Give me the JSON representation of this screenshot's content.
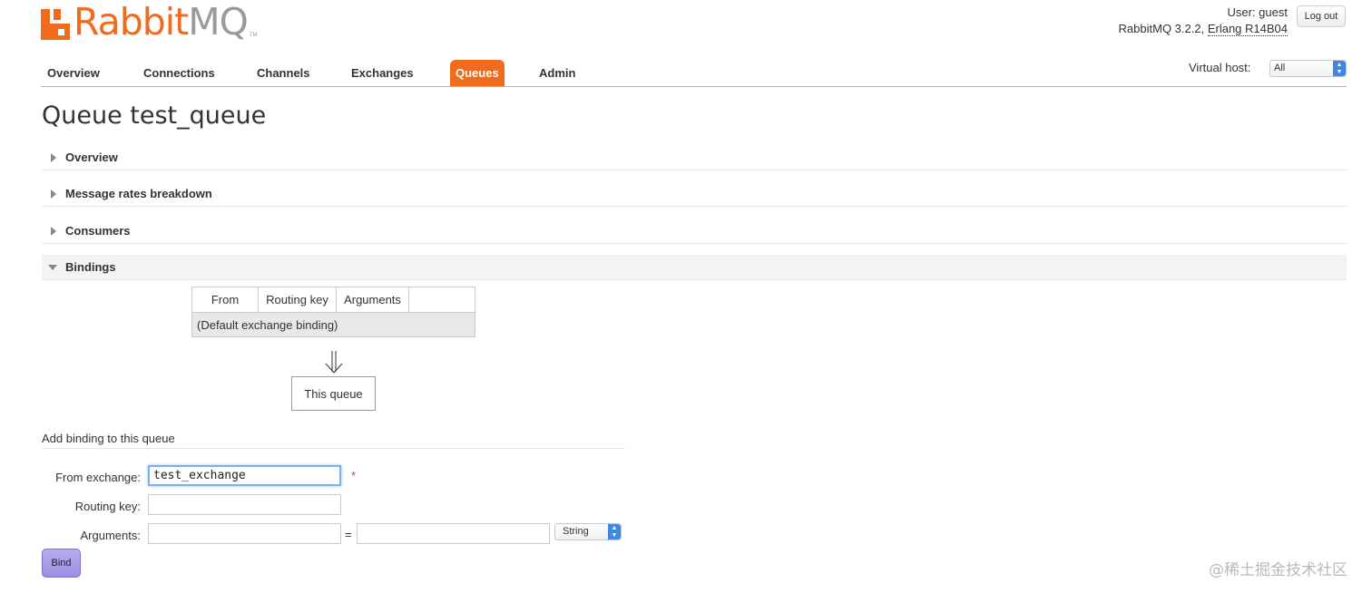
{
  "logo": {
    "name_orange": "Rabbit",
    "name_grey": "MQ",
    "tm": "TM"
  },
  "header": {
    "user": "User: guest",
    "version": "RabbitMQ 3.2.2, ",
    "erlang": "Erlang R14B04",
    "logout_label": "Log out"
  },
  "nav": {
    "items": [
      {
        "label": "Overview"
      },
      {
        "label": "Connections"
      },
      {
        "label": "Channels"
      },
      {
        "label": "Exchanges"
      },
      {
        "label": "Queues",
        "active": true
      },
      {
        "label": "Admin"
      }
    ],
    "vhost_label": "Virtual host:",
    "vhost_value": "All"
  },
  "page": {
    "title": "Queue test_queue"
  },
  "sections": [
    {
      "title": "Overview",
      "expanded": false
    },
    {
      "title": "Message rates breakdown",
      "expanded": false
    },
    {
      "title": "Consumers",
      "expanded": false
    },
    {
      "title": "Bindings",
      "expanded": true
    }
  ],
  "bindings": {
    "columns": [
      "From",
      "Routing key",
      "Arguments",
      ""
    ],
    "rows": [
      "(Default exchange binding)"
    ],
    "this_queue_label": "This queue"
  },
  "add_binding": {
    "title": "Add binding to this queue",
    "from_exchange_label": "From exchange:",
    "from_exchange_value": "test_exchange",
    "required_mark": "*",
    "routing_key_label": "Routing key:",
    "routing_key_value": "",
    "arguments_label": "Arguments:",
    "argument_key_value": "",
    "equals": "=",
    "argument_value": "",
    "type_value": "String",
    "bind_label": "Bind"
  },
  "watermark": "@稀土掘金技术社区",
  "colors": {
    "brand": "#f06b1b",
    "bind_button": "#a99fe8",
    "focus": "#7fb0ee"
  }
}
